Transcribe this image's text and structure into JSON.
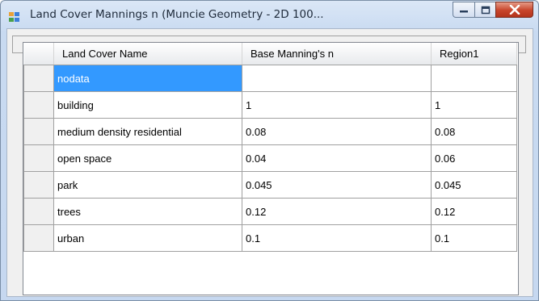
{
  "window": {
    "title": "Land Cover Mannings n (Muncie Geometry - 2D 100...",
    "controls": {
      "minimize": "minimize",
      "maximize": "maximize",
      "close": "close"
    }
  },
  "grid": {
    "headers": [
      "Land Cover Name",
      "Base Manning's n",
      "Region1"
    ],
    "rows": [
      {
        "name": "nodata",
        "base": "",
        "region1": ""
      },
      {
        "name": "building",
        "base": "1",
        "region1": "1"
      },
      {
        "name": "medium density residential",
        "base": "0.08",
        "region1": "0.08"
      },
      {
        "name": "open space",
        "base": "0.04",
        "region1": "0.06"
      },
      {
        "name": "park",
        "base": "0.045",
        "region1": "0.045"
      },
      {
        "name": "trees",
        "base": "0.12",
        "region1": "0.12"
      },
      {
        "name": "urban",
        "base": "0.1",
        "region1": "0.1"
      }
    ],
    "selected_cell": "nodata"
  },
  "colors": {
    "selection": "#3399ff",
    "close_button": "#c8442a",
    "title_bar": "#c8daf1"
  },
  "icons": {
    "app": "datagrid-app-icon",
    "minimize": "minimize-icon",
    "maximize": "maximize-icon",
    "close": "close-icon"
  }
}
